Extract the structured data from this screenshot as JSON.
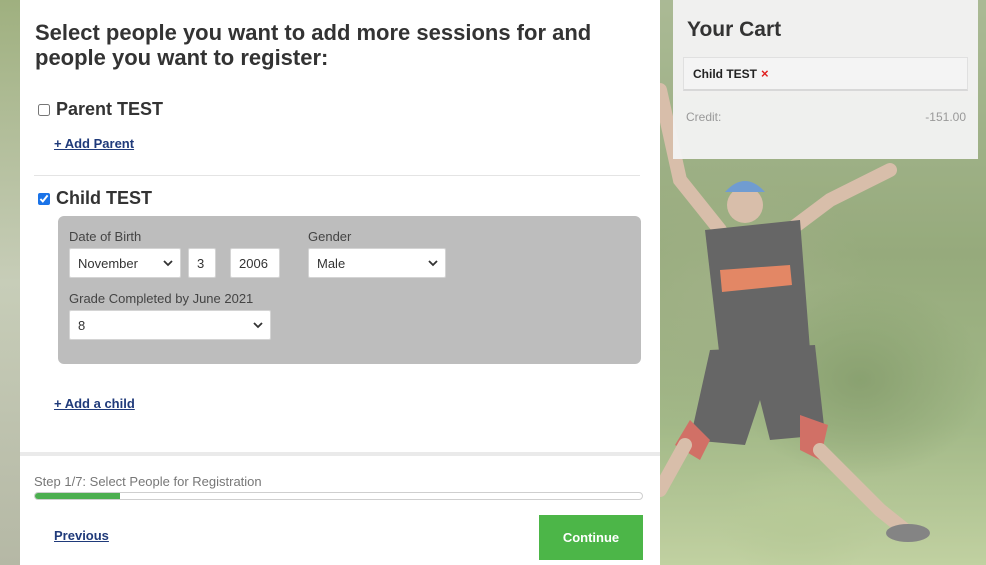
{
  "form": {
    "heading": "Select people you want to add more sessions for and people you want to register:",
    "parent": {
      "name": "Parent TEST",
      "checked": false,
      "add_link": "+ Add Parent"
    },
    "child": {
      "name": "Child TEST",
      "checked": true,
      "dob_label": "Date of Birth",
      "dob_month": "November",
      "dob_day": "3",
      "dob_year": "2006",
      "gender_label": "Gender",
      "gender_value": "Male",
      "grade_label": "Grade Completed by June 2021",
      "grade_value": "8",
      "add_link": "+ Add a child"
    }
  },
  "footer": {
    "step_text": "Step 1/7: Select People for Registration",
    "progress": 0.14,
    "previous_label": "Previous",
    "continue_label": "Continue"
  },
  "cart": {
    "title": "Your Cart",
    "item_name": "Child TEST",
    "remove_glyph": "×",
    "credit_label": "Credit:",
    "credit_value": "-151.00"
  },
  "colors": {
    "accent_green": "#4cb648",
    "link_blue": "#1f3a7a",
    "remove_red": "#e02020"
  }
}
